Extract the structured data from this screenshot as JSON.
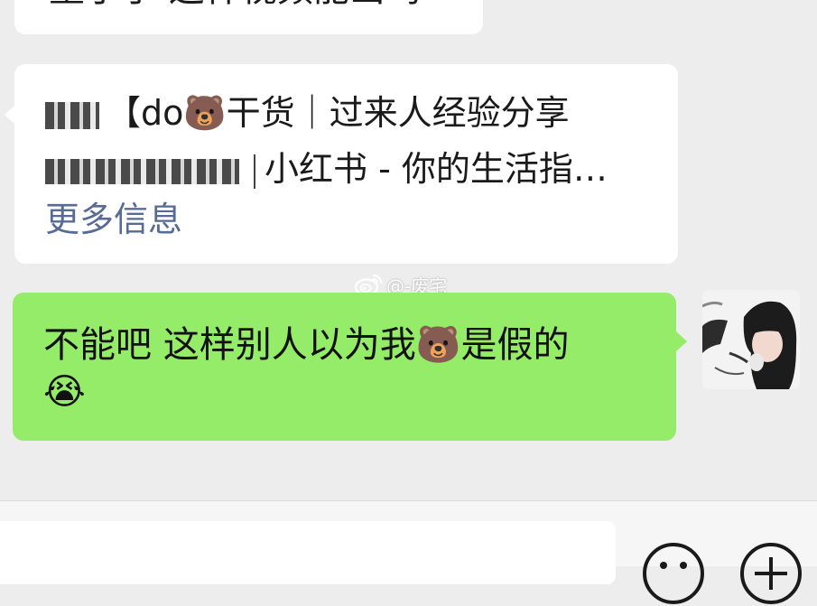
{
  "messages": {
    "top_partial": {
      "text": "重子了 这样视频能出吗"
    },
    "link_card": {
      "title_line_1": "【do🐻干货｜过来人经验分享",
      "title_line_2": "小红书 - 你的生活指…",
      "more_info": "更多信息",
      "redacted_text_icon": "redacted-blur"
    },
    "watermark": {
      "text": "@-废宅",
      "icon": "weibo-logo"
    },
    "mine": {
      "text": "不能吧 这样别人以为我🐻是假的",
      "emoji": "😭"
    }
  },
  "input_bar": {
    "input_value": "",
    "emoji_icon": "smiley-face-icon",
    "plus_icon": "plus-circle-icon"
  },
  "colors": {
    "background": "#ededed",
    "my_bubble": "#95ec69",
    "other_bubble": "#ffffff",
    "link_blue": "#576b95"
  }
}
